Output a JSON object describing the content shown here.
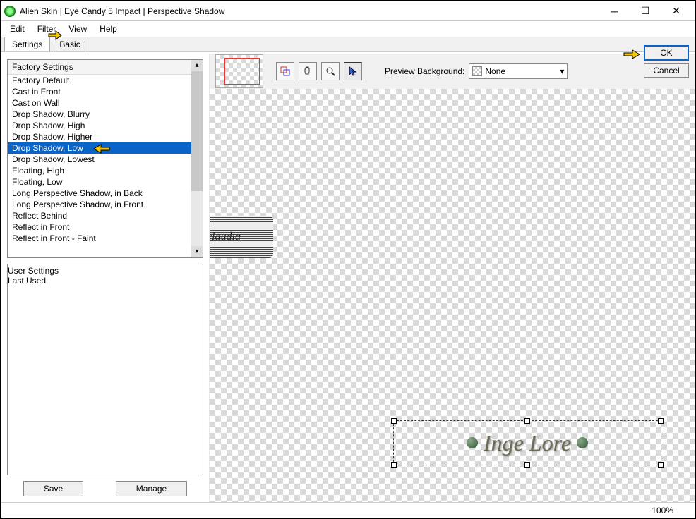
{
  "window": {
    "title": "Alien Skin | Eye Candy 5 Impact | Perspective Shadow"
  },
  "menu": {
    "edit": "Edit",
    "filter": "Filter",
    "view": "View",
    "help": "Help"
  },
  "tabs": {
    "settings": "Settings",
    "basic": "Basic"
  },
  "factory": {
    "header": "Factory Settings",
    "items": [
      "Factory Default",
      "Cast in Front",
      "Cast on Wall",
      "Drop Shadow, Blurry",
      "Drop Shadow, High",
      "Drop Shadow, Higher",
      "Drop Shadow, Low",
      "Drop Shadow, Lowest",
      "Floating, High",
      "Floating, Low",
      "Long Perspective Shadow, in Back",
      "Long Perspective Shadow, in Front",
      "Reflect Behind",
      "Reflect in Front",
      "Reflect in Front - Faint"
    ],
    "selected_index": 6
  },
  "user": {
    "header": "User Settings",
    "items": [
      "Last Used"
    ]
  },
  "buttons": {
    "save": "Save",
    "manage": "Manage",
    "ok": "OK",
    "cancel": "Cancel"
  },
  "preview_bg": {
    "label": "Preview Background:",
    "value": "None"
  },
  "canvas": {
    "text": "Inge Lore",
    "watermark": "claudia"
  },
  "status": {
    "zoom": "100%"
  }
}
